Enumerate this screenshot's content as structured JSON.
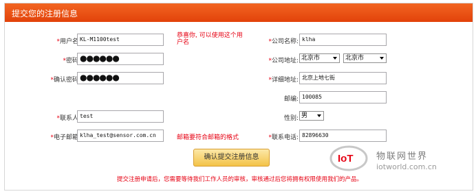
{
  "header": {
    "title": "提交您的注册信息"
  },
  "form": {
    "username": {
      "label": "用户名:",
      "value": "KL-M1100test",
      "hint": "恭喜你, 可以使用这个用户名"
    },
    "password": {
      "label": "密码:",
      "value": "●●●●●●"
    },
    "confirm_password": {
      "label": "确认密码:",
      "value": "●●●●●●"
    },
    "contact": {
      "label": "联系人:",
      "value": "test"
    },
    "email": {
      "label": "电子邮箱:",
      "value": "klha_test@sensor.com.cn",
      "hint": "邮箱要符合邮箱的格式"
    },
    "company_name": {
      "label": "公司名称:",
      "value": "klha"
    },
    "company_address": {
      "label": "公司地址:",
      "province": "北京市",
      "city": "北京市"
    },
    "detail_address": {
      "label": "详细地址:",
      "value": "北京上地七街"
    },
    "postcode": {
      "label": "邮编:",
      "value": "100085"
    },
    "gender": {
      "label": "性别:",
      "value": "男"
    },
    "phone": {
      "label": "联系电话:",
      "value": "82896630"
    },
    "required_mark": "*"
  },
  "submit": {
    "label": "确认提交注册信息"
  },
  "notice": "提交注册申请后，您需要等待我们工作人员的审核，审核通过后您将拥有权限使用我们的产品。",
  "watermark": {
    "cn": "物联网世界",
    "en": "iotworld.com.cn"
  },
  "colors": {
    "accent": "#e2420a",
    "error": "#e60012"
  }
}
